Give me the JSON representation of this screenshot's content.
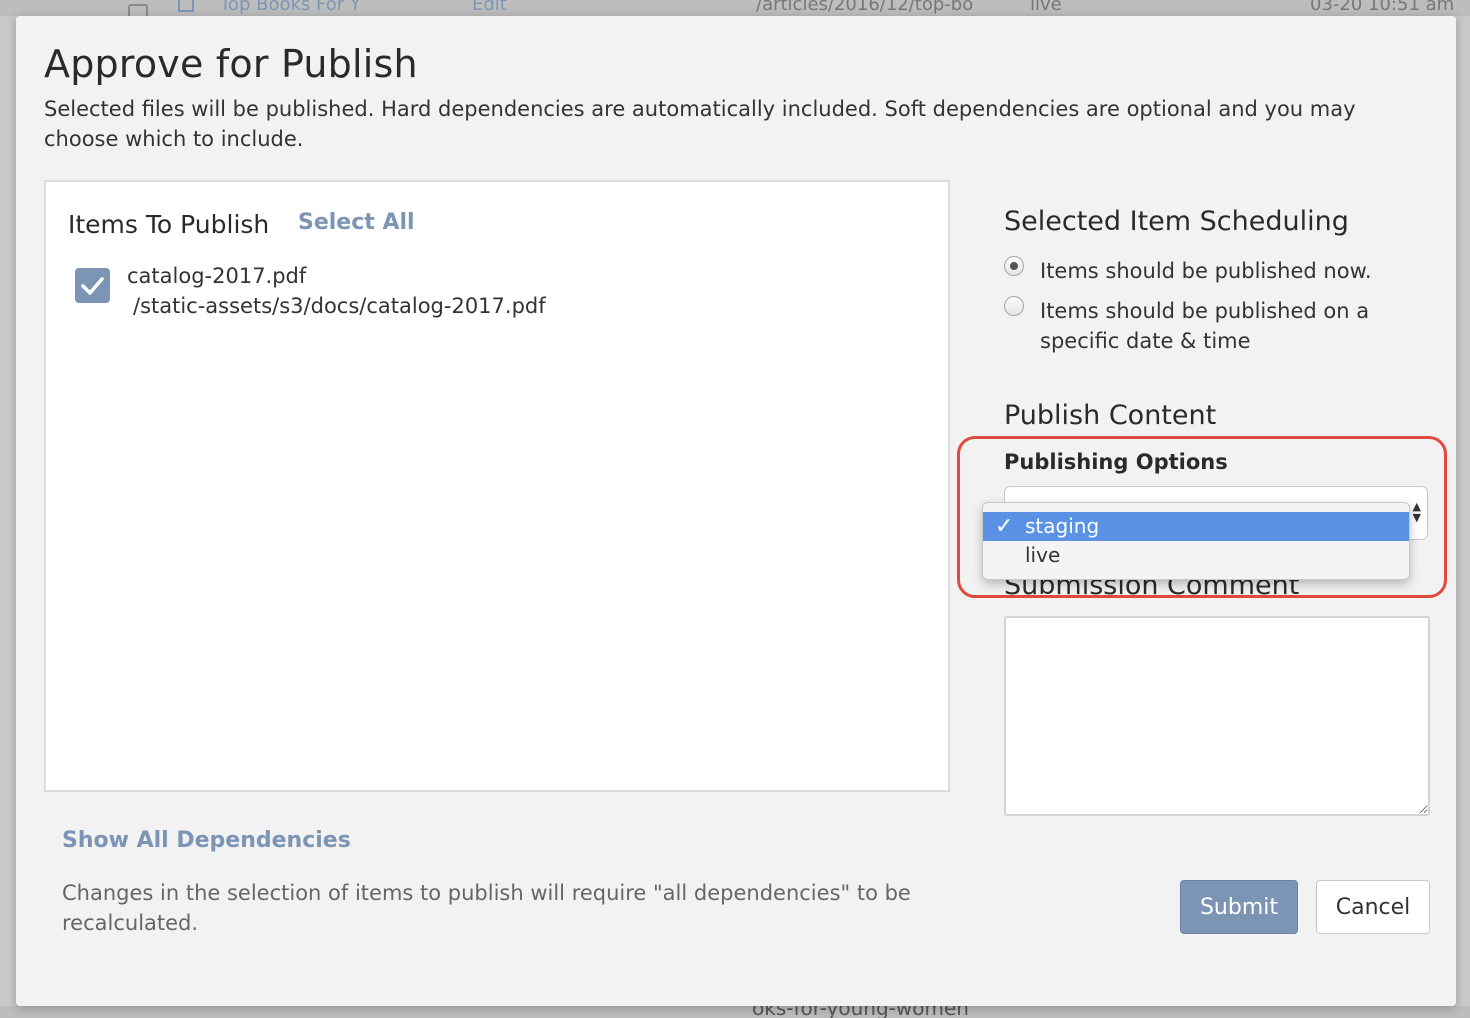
{
  "background": {
    "row_name": "Top Books For Y",
    "row_action": "Edit",
    "row_path": "/articles/2016/12/top-bo",
    "row_env": "live",
    "row_date": "03-20 10:51 am",
    "bottom_text": "oks-for-young-women"
  },
  "modal": {
    "title": "Approve for Publish",
    "subtitle": "Selected files will be published. Hard dependencies are automatically included. Soft dependencies are optional and you may choose which to include."
  },
  "items": {
    "heading": "Items To Publish",
    "select_all": "Select All",
    "list": [
      {
        "name": "catalog-2017.pdf",
        "path": "/static-assets/s3/docs/catalog-2017.pdf",
        "checked": true
      }
    ]
  },
  "dependencies": {
    "show_all": "Show All Dependencies",
    "note": "Changes in the selection of items to publish will require \"all dependencies\" to be recalculated."
  },
  "scheduling": {
    "heading": "Selected Item Scheduling",
    "option_now": "Items should be published now.",
    "option_later": "Items should be published on a specific date & time",
    "selected": "now"
  },
  "publish": {
    "heading": "Publish Content",
    "options_label": "Publishing Options",
    "options": [
      "staging",
      "live"
    ],
    "selected": "staging",
    "check_glyph": "✓"
  },
  "comment": {
    "heading": "Submission Comment",
    "value": ""
  },
  "buttons": {
    "submit": "Submit",
    "cancel": "Cancel"
  },
  "colors": {
    "accent": "#7d95b4",
    "highlight": "#e04a3c",
    "dropdown_selected": "#5a93e6"
  }
}
